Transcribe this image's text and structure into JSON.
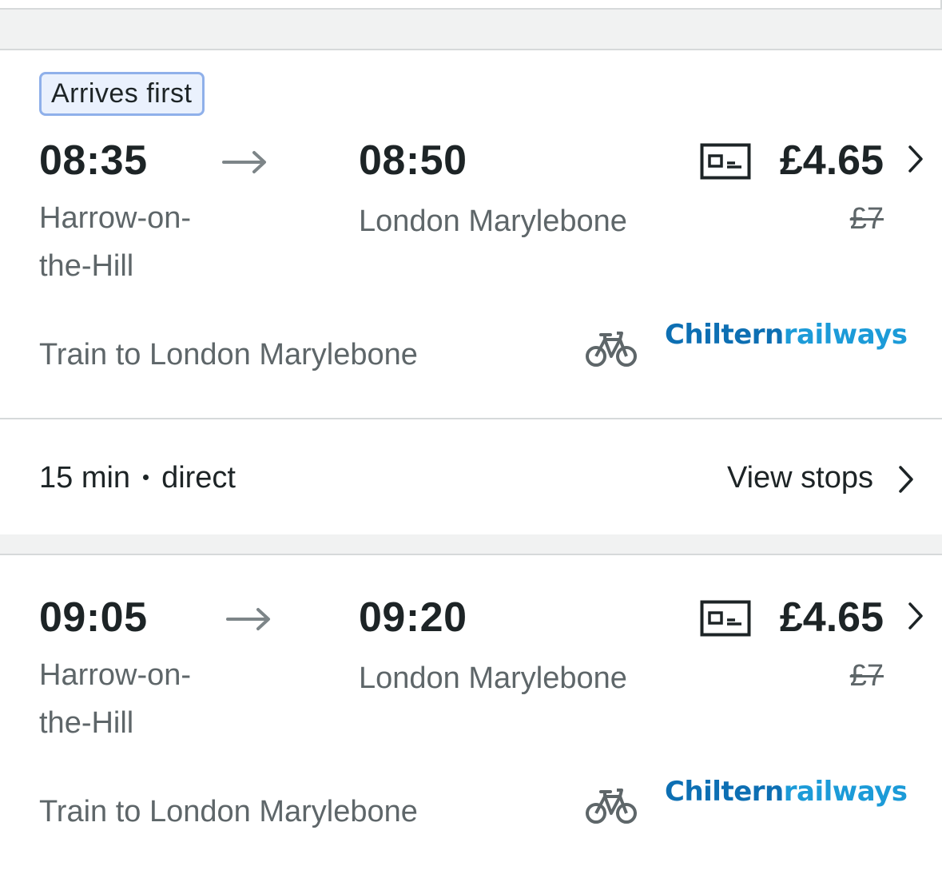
{
  "journeys": [
    {
      "badge": "Arrives first",
      "depart_time": "08:35",
      "arrive_time": "08:50",
      "from_station_line1": "Harrow-on-",
      "from_station_line2": "the-Hill",
      "to_station": "London Marylebone",
      "price": "£4.65",
      "original_price": "£7",
      "service": "Train to London Marylebone",
      "operator_part1": "Chiltern",
      "operator_part2": "railways",
      "duration": "15 min",
      "changes": "direct",
      "view_stops_label": "View stops"
    },
    {
      "depart_time": "09:05",
      "arrive_time": "09:20",
      "from_station_line1": "Harrow-on-",
      "from_station_line2": "the-Hill",
      "to_station": "London Marylebone",
      "price": "£4.65",
      "original_price": "£7",
      "service": "Train to London Marylebone",
      "operator_part1": "Chiltern",
      "operator_part2": "railways"
    }
  ],
  "icons": {
    "arrow": "arrow-right-icon",
    "ticket": "railcard-ticket-icon",
    "bike": "bicycle-icon",
    "chevron": "chevron-right-icon"
  },
  "colors": {
    "text_primary": "#1d2426",
    "text_secondary": "#5e6669",
    "badge_border": "#8fb0ea",
    "badge_bg": "#eaf1fd",
    "operator_dark": "#0d6fb3",
    "operator_light": "#1c9bd8",
    "background": "#f1f2f2"
  }
}
